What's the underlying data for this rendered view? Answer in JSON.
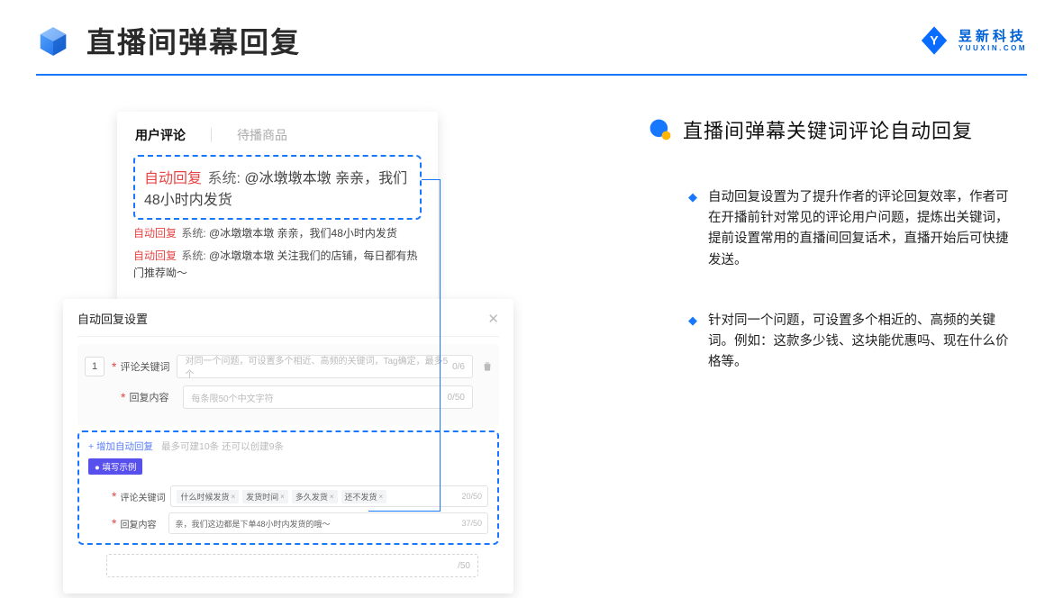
{
  "header": {
    "title": "直播间弹幕回复",
    "logo_cn": "昱新科技",
    "logo_en": "YUUXIN.COM"
  },
  "comments_panel": {
    "tab_active": "用户评论",
    "tab_inactive": "待播商品",
    "highlight_badge": "自动回复",
    "highlight_sys": "系统: ",
    "highlight_text": "@冰墩墩本墩 亲亲，我们48小时内发货",
    "line2_badge": "自动回复",
    "line2_sys": "系统: ",
    "line2_text": "@冰墩墩本墩 亲亲，我们48小时内发货",
    "line3_badge": "自动回复",
    "line3_sys": "系统: ",
    "line3_text": "@冰墩墩本墩 关注我们的店铺，每日都有热门推荐呦～"
  },
  "settings_panel": {
    "title": "自动回复设置",
    "index": "1",
    "label_keyword": "评论关键词",
    "keyword_placeholder": "对同一个问题，可设置多个相近、高频的关键词，Tag确定，最多5个",
    "keyword_count": "0/6",
    "label_content": "回复内容",
    "content_placeholder": "每条限50个中文字符",
    "content_count": "0/50",
    "add_link": "+ 增加自动回复",
    "add_hint": "最多可建10条 还可以创建9条",
    "example_badge": "● 填写示例",
    "ex_label_keyword": "评论关键词",
    "ex_tag1": "什么时候发货",
    "ex_tag2": "发货时间",
    "ex_tag3": "多久发货",
    "ex_tag4": "还不发货",
    "ex_keyword_count": "20/50",
    "ex_label_content": "回复内容",
    "ex_content_text": "亲，我们这边都是下单48小时内发货的哦～",
    "ex_content_count": "37/50",
    "ghost_count": "/50"
  },
  "right": {
    "title": "直播间弹幕关键词评论自动回复",
    "bullet1": "自动回复设置为了提升作者的评论回复效率，作者可在开播前针对常见的评论用户问题，提炼出关键词，提前设置常用的直播间回复话术，直播开始后可快捷发送。",
    "bullet2": "针对同一个问题，可设置多个相近的、高频的关键词。例如：这款多少钱、这块能优惠吗、现在什么价格等。"
  }
}
